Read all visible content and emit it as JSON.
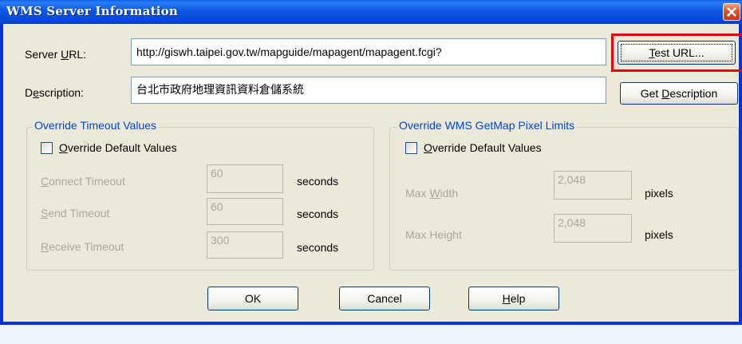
{
  "window": {
    "title": "WMS Server Information"
  },
  "server_url": {
    "label_pre": "Server ",
    "label_u": "U",
    "label_post": "RL:",
    "value": "http://giswh.taipei.gov.tw/mapguide/mapagent/mapagent.fcgi?"
  },
  "description": {
    "label_pre": "D",
    "label_u": "e",
    "label_post": "scription:",
    "value": "台北市政府地理資訊資料倉儲系統"
  },
  "buttons": {
    "test_url": {
      "u": "T",
      "rest": "est URL..."
    },
    "get_description": {
      "pre": "Get ",
      "u": "D",
      "rest": "escription"
    },
    "ok": "OK",
    "cancel": "Cancel",
    "help": {
      "u": "H",
      "rest": "elp"
    }
  },
  "timeout_group": {
    "title": "Override Timeout Values",
    "checkbox": {
      "u": "O",
      "rest": "verride Default Values"
    },
    "rows": [
      {
        "u": "C",
        "rest": "onnect Timeout",
        "value": "60",
        "unit": "seconds"
      },
      {
        "u": "S",
        "rest": "end Timeout",
        "value": "60",
        "unit": "seconds"
      },
      {
        "u": "R",
        "rest": "eceive Timeout",
        "value": "300",
        "unit": "seconds"
      }
    ]
  },
  "pixel_group": {
    "title": "Override WMS GetMap Pixel Limits",
    "checkbox": {
      "u": "O",
      "rest": "verride Default Values"
    },
    "rows": [
      {
        "pre": "Max ",
        "u": "W",
        "rest": "idth",
        "value": "2,048",
        "unit": "pixels"
      },
      {
        "pre": "Max Hei",
        "u": "g",
        "rest": "ht",
        "value": "2,048",
        "unit": "pixels"
      }
    ]
  },
  "colors": {
    "highlight": "#e8000e",
    "titlebar": "#0b57e4",
    "group_title": "#0046d5"
  }
}
